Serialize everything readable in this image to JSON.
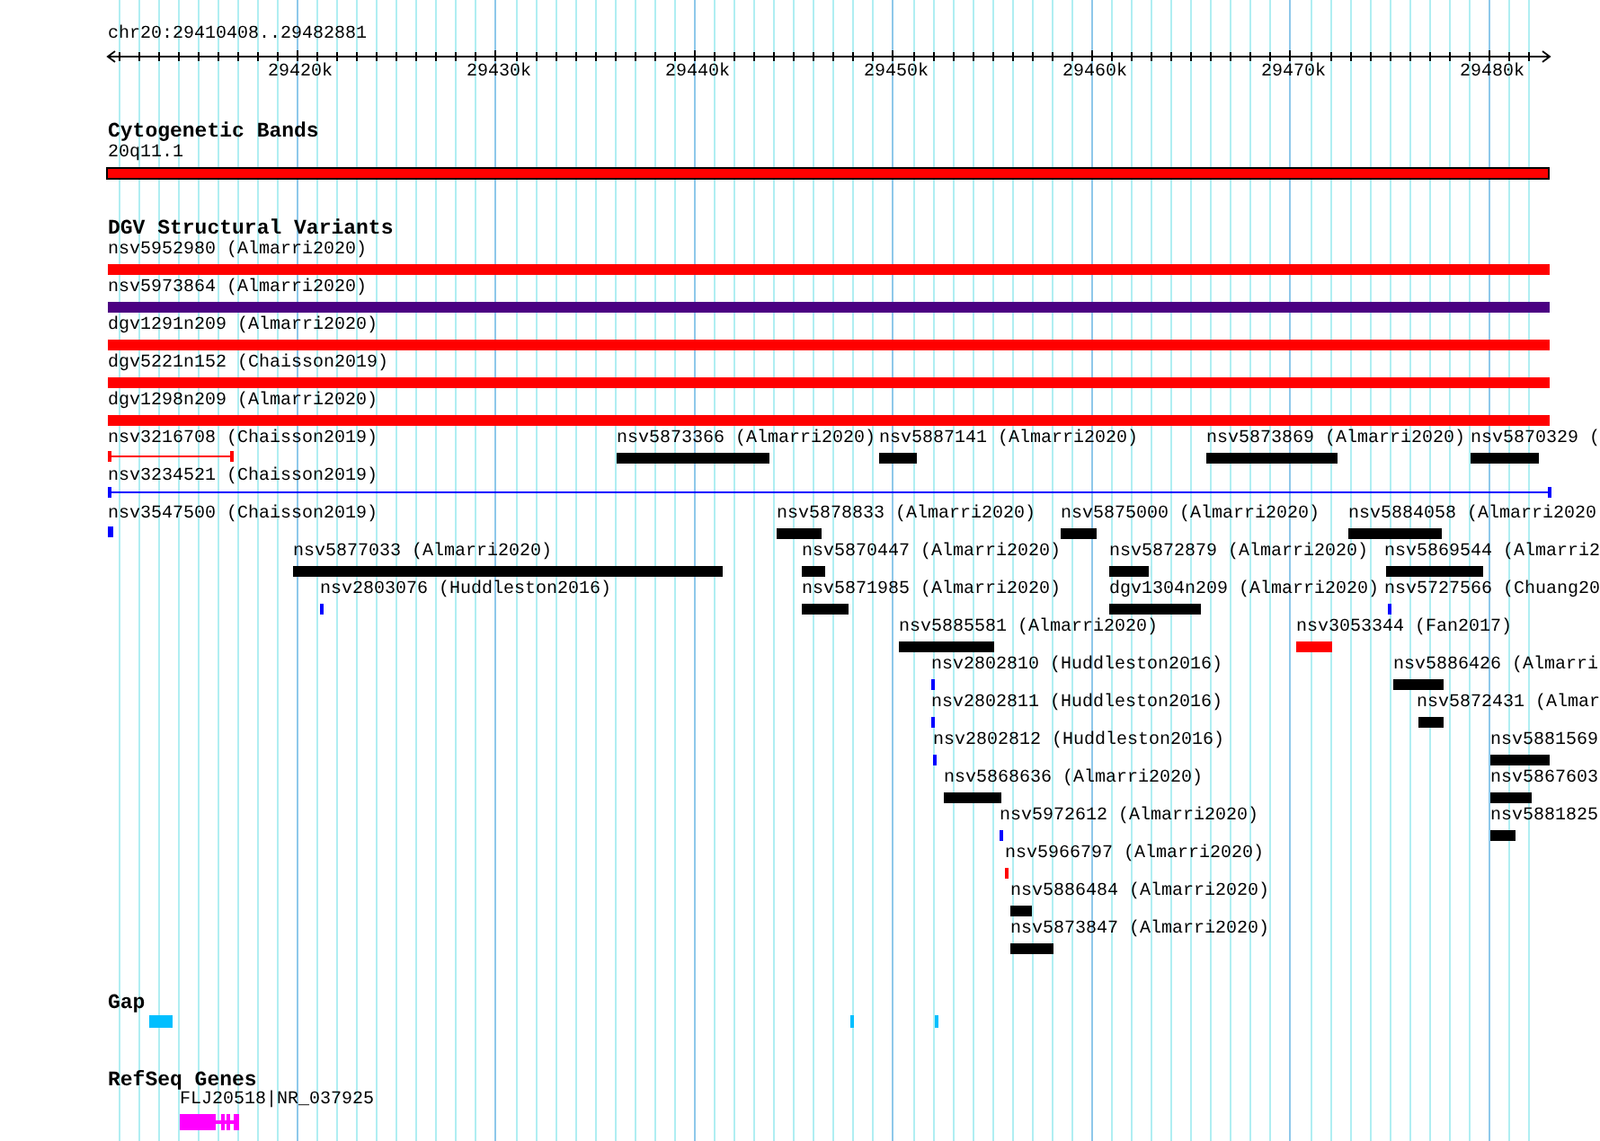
{
  "ruler": {
    "location": "chr20:29410408..29482881",
    "ticks": [
      "29420k",
      "29430k",
      "29440k",
      "29450k",
      "29460k",
      "29470k",
      "29480k"
    ]
  },
  "tracks": [
    {
      "title": "Cytogenetic Bands",
      "kind": "cytoband",
      "features": [
        {
          "label": "20q11.1",
          "color": "#ff0000",
          "kind": "bar"
        }
      ]
    },
    {
      "title": "DGV Structural Variants",
      "kind": "variants",
      "features": [
        {
          "label": "nsv5952980 (Almarri2020)",
          "color": "#ff0000",
          "kind": "bar"
        },
        {
          "label": "nsv5973864 (Almarri2020)",
          "color": "#4b0082",
          "kind": "bar"
        },
        {
          "label": "dgv1291n209 (Almarri2020)",
          "color": "#ff0000",
          "kind": "bar"
        },
        {
          "label": "dgv5221n152 (Chaisson2019)",
          "color": "#ff0000",
          "kind": "bar"
        },
        {
          "label": "dgv1298n209 (Almarri2020)",
          "color": "#ff0000",
          "kind": "bar"
        },
        {
          "label": "nsv3216708 (Chaisson2019)",
          "color": "#ff0000",
          "kind": "line"
        },
        {
          "label": "nsv5873366 (Almarri2020)",
          "color": "#000000",
          "kind": "bar"
        },
        {
          "label": "nsv5887141 (Almarri2020)",
          "color": "#000000",
          "kind": "bar"
        },
        {
          "label": "nsv5873869 (Almarri2020)",
          "color": "#000000",
          "kind": "bar"
        },
        {
          "label": "nsv5870329 (",
          "color": "#000000",
          "kind": "bar"
        },
        {
          "label": "nsv3234521 (Chaisson2019)",
          "color": "#0000ff",
          "kind": "line"
        },
        {
          "label": "nsv3547500 (Chaisson2019)",
          "color": "#0000ff",
          "kind": "bar"
        },
        {
          "label": "nsv5878833 (Almarri2020)",
          "color": "#000000",
          "kind": "bar"
        },
        {
          "label": "nsv5875000 (Almarri2020)",
          "color": "#000000",
          "kind": "bar"
        },
        {
          "label": "nsv5884058 (Almarri2020",
          "color": "#000000",
          "kind": "bar"
        },
        {
          "label": "nsv5877033 (Almarri2020)",
          "color": "#000000",
          "kind": "bar"
        },
        {
          "label": "nsv5870447 (Almarri2020)",
          "color": "#000000",
          "kind": "bar"
        },
        {
          "label": "nsv5872879 (Almarri2020)",
          "color": "#000000",
          "kind": "bar"
        },
        {
          "label": "nsv5869544 (Almarri2",
          "color": "#000000",
          "kind": "bar"
        },
        {
          "label": "nsv2803076 (Huddleston2016)",
          "color": "#0000ff",
          "kind": "bar"
        },
        {
          "label": "nsv5871985 (Almarri2020)",
          "color": "#000000",
          "kind": "bar"
        },
        {
          "label": "dgv1304n209 (Almarri2020)",
          "color": "#000000",
          "kind": "bar"
        },
        {
          "label": "nsv5727566 (Chuang20",
          "color": "#0000ff",
          "kind": "bar"
        },
        {
          "label": "nsv5885581 (Almarri2020)",
          "color": "#000000",
          "kind": "bar"
        },
        {
          "label": "nsv3053344 (Fan2017)",
          "color": "#ff0000",
          "kind": "bar"
        },
        {
          "label": "nsv2802810 (Huddleston2016)",
          "color": "#0000ff",
          "kind": "bar"
        },
        {
          "label": "nsv5886426 (Almarri",
          "color": "#000000",
          "kind": "bar"
        },
        {
          "label": "nsv2802811 (Huddleston2016)",
          "color": "#0000ff",
          "kind": "bar"
        },
        {
          "label": "nsv5872431 (Almar",
          "color": "#000000",
          "kind": "bar"
        },
        {
          "label": "nsv2802812 (Huddleston2016)",
          "color": "#0000ff",
          "kind": "bar"
        },
        {
          "label": "nsv5881569",
          "color": "#000000",
          "kind": "bar"
        },
        {
          "label": "nsv5868636 (Almarri2020)",
          "color": "#000000",
          "kind": "bar"
        },
        {
          "label": "nsv5867603",
          "color": "#000000",
          "kind": "bar"
        },
        {
          "label": "nsv5972612 (Almarri2020)",
          "color": "#0000ff",
          "kind": "bar"
        },
        {
          "label": "nsv5881825",
          "color": "#000000",
          "kind": "bar"
        },
        {
          "label": "nsv5966797 (Almarri2020)",
          "color": "#ff0000",
          "kind": "bar"
        },
        {
          "label": "nsv5886484 (Almarri2020)",
          "color": "#000000",
          "kind": "bar"
        },
        {
          "label": "nsv5873847 (Almarri2020)",
          "color": "#000000",
          "kind": "bar"
        }
      ]
    },
    {
      "title": "Gap",
      "kind": "gap",
      "features": [
        {
          "color": "#00bfff",
          "kind": "bar"
        },
        {
          "color": "#00bfff",
          "kind": "bar"
        },
        {
          "color": "#00bfff",
          "kind": "bar"
        }
      ]
    },
    {
      "title": "RefSeq Genes",
      "kind": "genes",
      "features": [
        {
          "label": "FLJ20518|NR_037925",
          "color": "#ff00ff",
          "kind": "gene"
        }
      ]
    }
  ]
}
